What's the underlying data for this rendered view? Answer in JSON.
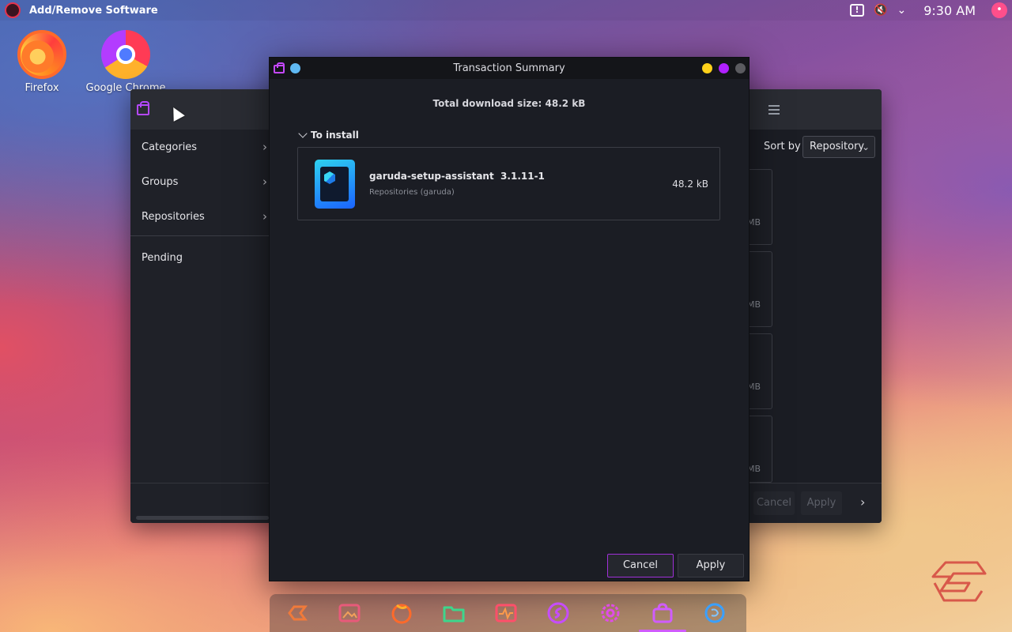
{
  "top_panel": {
    "title": "Add/Remove Software",
    "notification_glyph": "!",
    "volume_glyph": "🔇",
    "tray_chevron": "⌄",
    "clock": "9:30 AM",
    "avatar_letter": "•"
  },
  "desktop": {
    "icons": [
      {
        "label": "Firefox",
        "icon": "firefox-icon"
      },
      {
        "label": "Google Chrome",
        "icon": "chrome-icon"
      }
    ]
  },
  "bg_window": {
    "sidebar": {
      "items": [
        {
          "label": "Categories"
        },
        {
          "label": "Groups"
        },
        {
          "label": "Repositories"
        },
        {
          "label": "Pending"
        }
      ],
      "chevron": "›"
    },
    "sort_by_label": "Sort by",
    "sort_value": "Repository",
    "sort_chevron": "⌄",
    "package_sizes": [
      "MB",
      "MB",
      "MB",
      "MB"
    ],
    "cancel_label": "Cancel",
    "apply_label": "Apply",
    "next_glyph": "›"
  },
  "dialog": {
    "title": "Transaction Summary",
    "total_download": "Total download size: 48.2 kB",
    "section_label": "To install",
    "package": {
      "name": "garuda-setup-assistant  3.1.11-1",
      "repository": "Repositories (garuda)",
      "size": "48.2 kB"
    },
    "cancel_label": "Cancel",
    "apply_label": "Apply"
  },
  "dock": {
    "items": [
      {
        "icon": "garuda-welcome-icon",
        "color": "#f07a3a"
      },
      {
        "icon": "image-viewer-icon",
        "color": "#e85a7a"
      },
      {
        "icon": "firefox-icon",
        "color": "#ff6a2a"
      },
      {
        "icon": "file-manager-icon",
        "color": "#3dd68c"
      },
      {
        "icon": "system-monitor-icon",
        "color": "#ff4f6a"
      },
      {
        "icon": "hello-icon",
        "color": "#c64cff"
      },
      {
        "icon": "settings-icon",
        "color": "#e04ce8"
      },
      {
        "icon": "software-store-icon",
        "color": "#d05cff"
      },
      {
        "icon": "refresh-tool-icon",
        "color": "#3aa0ff"
      }
    ]
  }
}
